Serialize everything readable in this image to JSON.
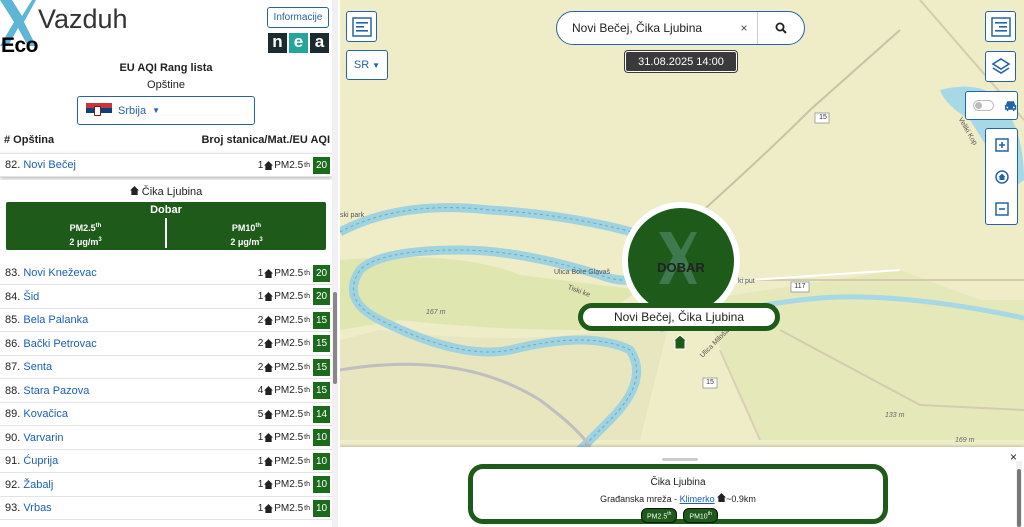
{
  "app": {
    "title": "Vazduh",
    "subtitle": "Eco",
    "info_button": "Informacije",
    "nea_logo": [
      "n",
      "e",
      "a"
    ]
  },
  "ranking": {
    "title": "EU AQI Rang lista",
    "subtitle": "Opštine",
    "country": "Srbija",
    "col_left": "# Opština",
    "col_right": "Broj stanica/Mat./EU AQI"
  },
  "selected": {
    "rank": "82.",
    "name": "Novi Bečej",
    "count": "1",
    "pollutant": "PM2.5",
    "sup": "th",
    "aqi": "20"
  },
  "station": {
    "name": "Čika Ljubina",
    "status": "Dobar",
    "pm25_label": "PM2.5",
    "pm25_sup": "th",
    "pm25_value": "2 μg/m",
    "pm10_label": "PM10",
    "pm10_sup": "th",
    "pm10_value": "2 μg/m",
    "unit_sup": "3"
  },
  "rows": [
    {
      "rank": "83.",
      "name": "Novi Kneževac",
      "count": "1",
      "pollutant": "PM2.5",
      "sup": "th",
      "aqi": "20"
    },
    {
      "rank": "84.",
      "name": "Šid",
      "count": "1",
      "pollutant": "PM2.5",
      "sup": "th",
      "aqi": "20"
    },
    {
      "rank": "85.",
      "name": "Bela Palanka",
      "count": "2",
      "pollutant": "PM2.5",
      "sup": "th",
      "aqi": "15"
    },
    {
      "rank": "86.",
      "name": "Bački Petrovac",
      "count": "2",
      "pollutant": "PM2.5",
      "sup": "th",
      "aqi": "15"
    },
    {
      "rank": "87.",
      "name": "Senta",
      "count": "2",
      "pollutant": "PM2.5",
      "sup": "th",
      "aqi": "15"
    },
    {
      "rank": "88.",
      "name": "Stara Pazova",
      "count": "4",
      "pollutant": "PM2.5",
      "sup": "th",
      "aqi": "15"
    },
    {
      "rank": "89.",
      "name": "Kovačica",
      "count": "5",
      "pollutant": "PM2.5",
      "sup": "th",
      "aqi": "14"
    },
    {
      "rank": "90.",
      "name": "Varvarin",
      "count": "1",
      "pollutant": "PM2.5",
      "sup": "th",
      "aqi": "10"
    },
    {
      "rank": "91.",
      "name": "Ćuprija",
      "count": "1",
      "pollutant": "PM2.5",
      "sup": "th",
      "aqi": "10"
    },
    {
      "rank": "92.",
      "name": "Žabalj",
      "count": "1",
      "pollutant": "PM2.5",
      "sup": "th",
      "aqi": "10"
    },
    {
      "rank": "93.",
      "name": "Vrbas",
      "count": "1",
      "pollutant": "PM2.5",
      "sup": "th",
      "aqi": "10"
    }
  ],
  "map": {
    "language_button": "SR",
    "search_value": "Novi Bečej, Čika Ljubina",
    "search_clear": "×",
    "datetime": "31.08.2025 14:00",
    "marker_status": "DOBAR",
    "marker_label": "Novi Bečej, Čika Ljubina",
    "labels": {
      "park": "ski park",
      "bore": "Ulica Bore Glavaš",
      "put": "ki put",
      "tiski": "Tiski ke",
      "milos": "Ulica Miloša",
      "veliki": "Veliki Kop",
      "elev1": "167 m",
      "elev2": "133 m",
      "elev3": "169 m",
      "road15a": "15",
      "road15b": "15",
      "road117": "117"
    }
  },
  "bottom": {
    "close": "×",
    "title": "Čika Ljubina",
    "network": "Građanska mreža - ",
    "provider": "Klimerko",
    "distance": "~0.9km",
    "badge1": "PM2.5",
    "badge1_sup": "th",
    "badge2": "PM10",
    "badge2_sup": "th"
  },
  "colors": {
    "good": "#1e5b1a",
    "aqi_box": "#1c6b1c",
    "accent": "#2563a8",
    "river": "#a6d8e6",
    "land": "#efecc8"
  }
}
